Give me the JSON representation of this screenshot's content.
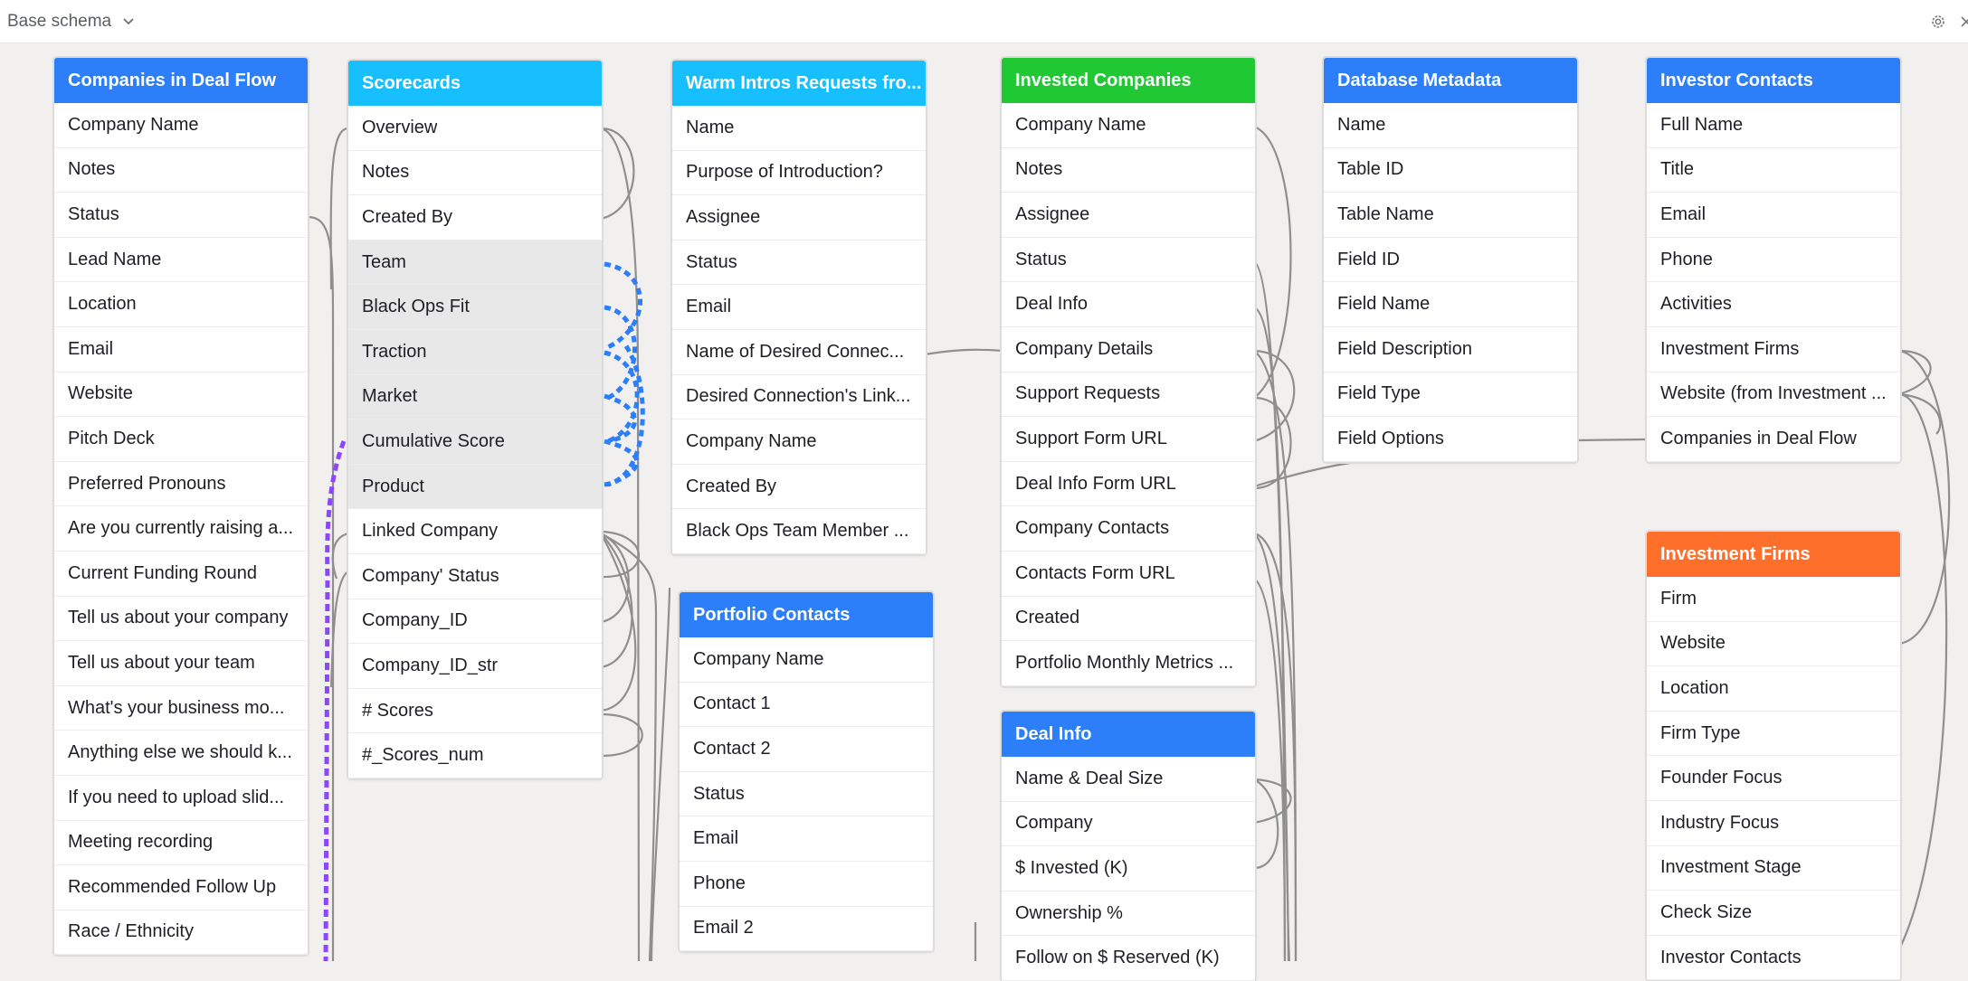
{
  "schema_selector": {
    "label": "Base schema"
  },
  "colors": {
    "blue": "#2d7ff9",
    "cyan": "#18bfff",
    "green": "#20c933",
    "orange": "#ff6f2c",
    "link_blue": "#2d7ff9",
    "link_purple": "#8b46ff",
    "line_gray": "#8f8f8f"
  },
  "tables": [
    {
      "name": "Companies in Deal Flow",
      "color": "blue",
      "fields": [
        "Company Name",
        "Notes",
        "Status",
        "Lead Name",
        "Location",
        "Email",
        "Website",
        "Pitch Deck",
        "Preferred Pronouns",
        "Are you currently raising a...",
        "Current Funding Round",
        "Tell us about your company",
        "Tell us about your team",
        "What's your business mo...",
        "Anything else we should k...",
        "If you need to upload slid...",
        "Meeting recording",
        "Recommended Follow Up",
        "Race / Ethnicity"
      ]
    },
    {
      "name": "Scorecards",
      "color": "cyan",
      "fields": [
        "Overview",
        "Notes",
        "Created By",
        "Team",
        "Black Ops Fit",
        "Traction",
        "Market",
        "Cumulative Score",
        "Product",
        "Linked Company",
        "Company' Status",
        "Company_ID",
        "Company_ID_str",
        "# Scores",
        "#_Scores_num"
      ],
      "highlighted": [
        "Team",
        "Black Ops Fit",
        "Traction",
        "Market",
        "Cumulative Score",
        "Product"
      ]
    },
    {
      "name": "Warm Intros Requests fro...",
      "color": "cyan",
      "fields": [
        "Name",
        "Purpose of Introduction?",
        "Assignee",
        "Status",
        "Email",
        "Name of Desired Connec...",
        "Desired Connection's Link...",
        "Company Name",
        "Created By",
        "Black Ops Team Member ..."
      ]
    },
    {
      "name": "Portfolio Contacts",
      "color": "blue",
      "fields": [
        "Company Name",
        "Contact 1",
        "Contact 2",
        "Status",
        "Email",
        "Phone",
        "Email 2"
      ]
    },
    {
      "name": "Invested Companies",
      "color": "green",
      "fields": [
        "Company Name",
        "Notes",
        "Assignee",
        "Status",
        "Deal Info",
        "Company Details",
        "Support Requests",
        "Support Form URL",
        "Deal Info Form URL",
        "Company Contacts",
        "Contacts Form URL",
        "Created",
        "Portfolio Monthly Metrics ..."
      ]
    },
    {
      "name": "Deal Info",
      "color": "blue",
      "fields": [
        "Name & Deal Size",
        "Company",
        "$ Invested (K)",
        "Ownership %",
        "Follow on $ Reserved (K)"
      ]
    },
    {
      "name": "Database Metadata",
      "color": "blue",
      "fields": [
        "Name",
        "Table ID",
        "Table Name",
        "Field ID",
        "Field Name",
        "Field Description",
        "Field Type",
        "Field Options"
      ]
    },
    {
      "name": "Investor Contacts",
      "color": "blue",
      "fields": [
        "Full Name",
        "Title",
        "Email",
        "Phone",
        "Activities",
        "Investment Firms",
        "Website (from Investment ...",
        "Companies in Deal Flow"
      ]
    },
    {
      "name": "Investment Firms",
      "color": "orange",
      "fields": [
        "Firm",
        "Website",
        "Location",
        "Firm Type",
        "Founder Focus",
        "Industry Focus",
        "Investment Stage",
        "Check Size",
        "Investor Contacts"
      ]
    }
  ]
}
